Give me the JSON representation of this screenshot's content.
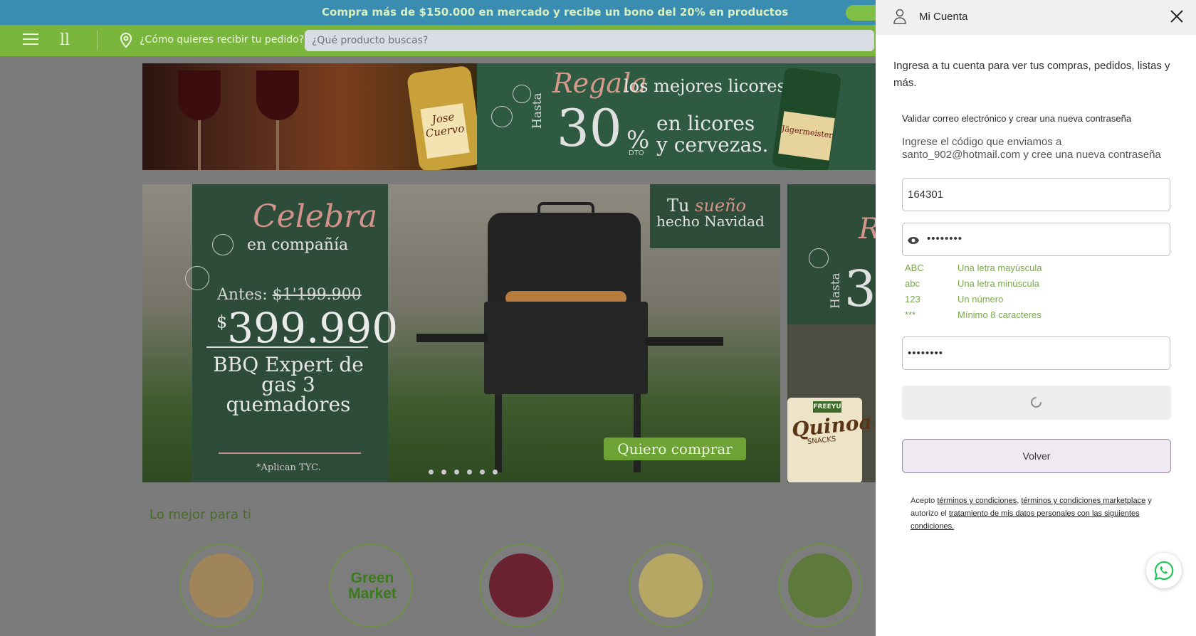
{
  "promo": {
    "text": "Compra más de $150.000 en mercado y recibe un bono del 20% en productos"
  },
  "navbar": {
    "logo": "ll",
    "delivery_label": "¿Cómo quieres recibir tu pedido?",
    "search_placeholder": "¿Qué producto buscas?"
  },
  "banner1": {
    "regala": "Regala",
    "mejores": "los mejores licores",
    "hasta": "Hasta",
    "percent": "30",
    "percent_sign": "%",
    "dto": "DTO",
    "licores_line1": "en licores",
    "licores_line2": "y cervezas.",
    "bottle1_label": "Jose Cuervo",
    "bottle2_label": "Jägermeister"
  },
  "banner2": {
    "celebra": "Celebra",
    "compania": "en compañía",
    "antes_label": "Antes: ",
    "antes_value": "$1'199.900",
    "price_symbol": "$",
    "price": "399.990",
    "product": "BBQ Expert de gas 3 quemadores",
    "tyc": "*Aplican TYC.",
    "tag_tu": "Tu ",
    "tag_sueno": "sueño",
    "tag_hecho": "hecho Navidad",
    "cta": "Quiero comprar",
    "slide_count": 6
  },
  "banner3": {
    "hasta": "Hasta",
    "number": "3",
    "title_initial": "R",
    "brand": "FREEYU",
    "product": "Quinoa",
    "product_sub": "SNACKS"
  },
  "section": {
    "title": "Lo mejor para ti"
  },
  "categories": [
    {
      "name": "gift-basket",
      "label": ""
    },
    {
      "name": "green-market",
      "label": "Green Market"
    },
    {
      "name": "wine",
      "label": ""
    },
    {
      "name": "dairy",
      "label": ""
    },
    {
      "name": "salad",
      "label": ""
    }
  ],
  "drawer": {
    "title": "Mi Cuenta",
    "intro": "Ingresa a tu cuenta para ver tus compras, pedidos, listas y más.",
    "validate_title": "Validar correo electrónico y crear una nueva contraseña",
    "instructions": "Ingrese el código que enviamos a santo_902@hotmail.com y cree una nueva contraseña",
    "code_value": "164301",
    "password_value": "••••••••",
    "confirm_value": "••••••••",
    "requirements": [
      {
        "code": "ABC",
        "label": "Una letra mayúscula"
      },
      {
        "code": "abc",
        "label": "Una letra minúscula"
      },
      {
        "code": "123",
        "label": "Un número"
      },
      {
        "code": "***",
        "label": "Mínimo 8 caracteres"
      }
    ],
    "back_label": "Volver",
    "terms_prefix": "Acepto ",
    "terms_link1": "términos y condiciones",
    "terms_sep": ", ",
    "terms_link2": "términos y condiciones marketplace",
    "terms_mid": " y autorizo el ",
    "terms_link3": "tratamiento de mis datos personales con las siguientes condiciones."
  },
  "colors": {
    "promo_bar": "#3a8cb0",
    "nav_green": "#7ab53c",
    "overlay": "#7b7b7b",
    "requirement_green": "#7aa84d",
    "back_button_bg": "#efe9f2"
  }
}
